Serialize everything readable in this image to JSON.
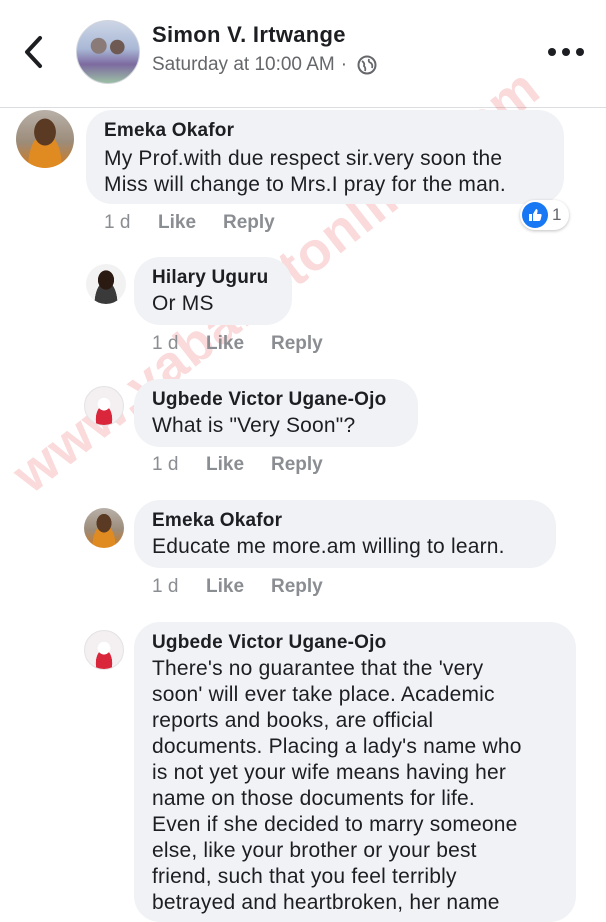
{
  "header": {
    "name": "Simon V. Irtwange",
    "time": "Saturday at 10:00 AM",
    "separator": "·",
    "privacy_icon": "globe-icon",
    "back_icon": "chevron-left-icon",
    "more_icon": "more-horizontal-icon"
  },
  "comments": [
    {
      "author": "Emeka Okafor",
      "text": "My Prof.with due respect sir.very soon the\nMiss will change to Mrs.I pray for the man.",
      "time": "1 d",
      "like": "Like",
      "reply": "Reply",
      "reaction_count": "1"
    },
    {
      "author": "Hilary Uguru",
      "text": "Or MS",
      "time": "1 d",
      "like": "Like",
      "reply": "Reply"
    },
    {
      "author": "Ugbede Victor Ugane-Ojo",
      "text": "What is \"Very Soon\"?",
      "time": "1 d",
      "like": "Like",
      "reply": "Reply"
    },
    {
      "author": "Emeka Okafor",
      "text": "Educate me more.am willing to learn.",
      "time": "1 d",
      "like": "Like",
      "reply": "Reply"
    },
    {
      "author": "Ugbede Victor Ugane-Ojo",
      "text": "There's no guarantee that the 'very\nsoon' will ever take place. Academic\nreports and books, are official\ndocuments. Placing a lady's name who\nis not yet your wife means having her\nname on those documents for life.\nEven if she decided to marry someone\nelse, like your brother or your best\nfriend, such that you feel terribly\nbetrayed and heartbroken, her name"
    }
  ],
  "watermark": "www.yabaleftonline.com",
  "colors": {
    "like_blue": "#1877f2",
    "bubble": "#f0f2f5",
    "watermark": "#e64646"
  }
}
